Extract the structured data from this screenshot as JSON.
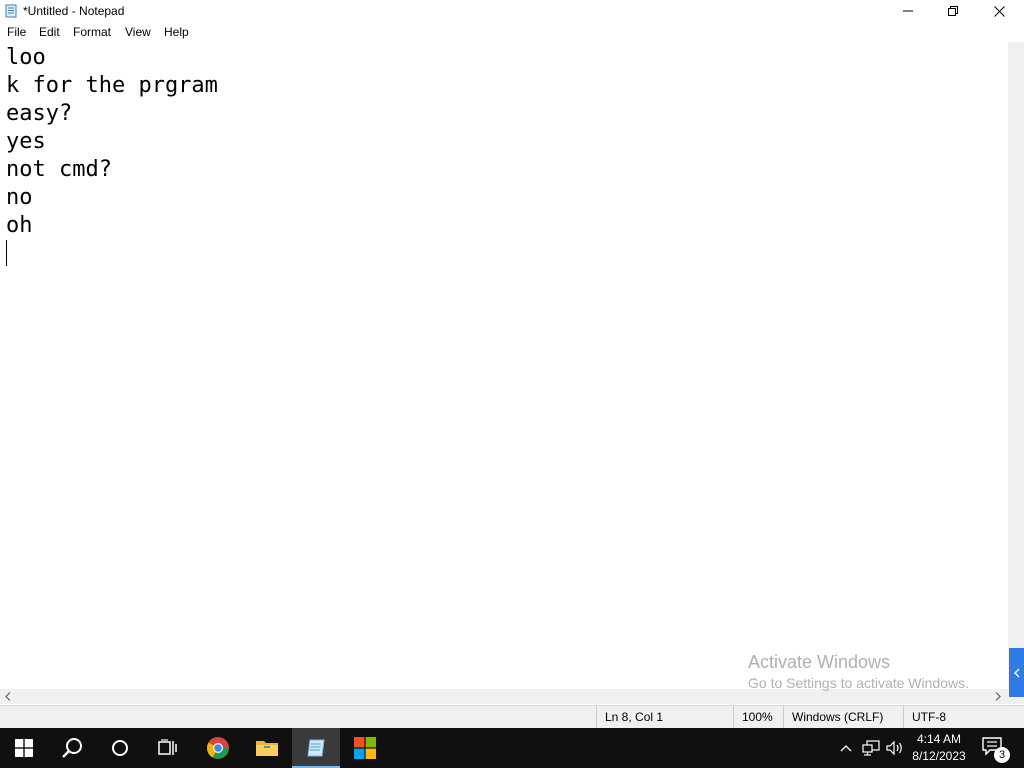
{
  "window": {
    "title": "*Untitled - Notepad",
    "controls": {
      "minimize": "minimize",
      "maximize": "restore",
      "close": "close"
    }
  },
  "menu": [
    "File",
    "Edit",
    "Format",
    "View",
    "Help"
  ],
  "editor": {
    "lines": [
      "loo",
      "k for the prgram",
      "easy?",
      "yes",
      "not cmd?",
      "no",
      "oh",
      ""
    ]
  },
  "watermark": {
    "title": "Activate Windows",
    "subtitle": "Go to Settings to activate Windows."
  },
  "status": {
    "position": "Ln 8, Col 1",
    "zoom": "100%",
    "line_ending": "Windows (CRLF)",
    "encoding": "UTF-8"
  },
  "taskbar": {
    "apps": [
      {
        "name": "start",
        "icon": "windows-logo-icon"
      },
      {
        "name": "search",
        "icon": "search-icon"
      },
      {
        "name": "cortana",
        "icon": "cortana-circle-icon"
      },
      {
        "name": "task-view",
        "icon": "task-view-icon"
      },
      {
        "name": "chrome",
        "icon": "chrome-icon"
      },
      {
        "name": "file-explorer",
        "icon": "folder-icon"
      },
      {
        "name": "notepad",
        "icon": "notepad-icon",
        "active": true
      },
      {
        "name": "microsoft-store",
        "icon": "store-icon"
      }
    ],
    "clock": {
      "time": "4:14 AM",
      "date": "8/12/2023"
    },
    "notifications": "3"
  },
  "colors": {
    "taskbar": "#101010",
    "accent": "#2d7be5",
    "statusbar": "#f0f0f0"
  }
}
